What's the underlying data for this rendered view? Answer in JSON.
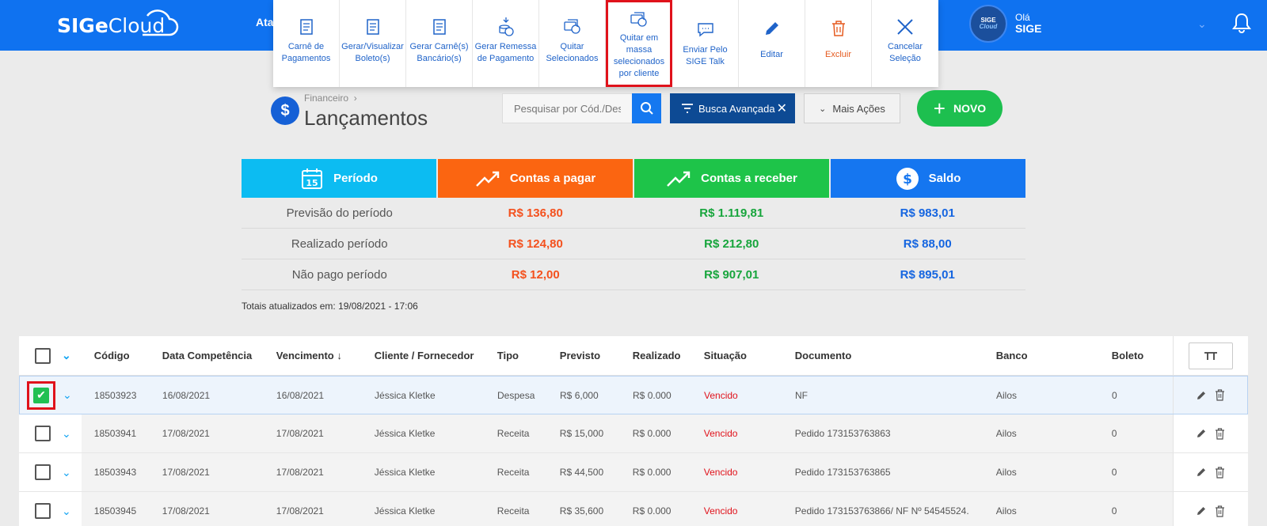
{
  "topbar": {
    "logo_sige": "SIGe",
    "logo_cloud": "Cloud",
    "nav_cut": "Ata",
    "user": {
      "avatar_top": "SIGE",
      "avatar_bottom": "Cloud",
      "greeting": "Olá",
      "name": "SIGE"
    }
  },
  "actions": [
    {
      "label": "Carnê de Pagamentos",
      "icon": "doc-icon"
    },
    {
      "label": "Gerar/Visualizar Boleto(s)",
      "icon": "doc-icon"
    },
    {
      "label": "Gerar Carnê(s) Bancário(s)",
      "icon": "doc-icon"
    },
    {
      "label": "Gerar Remessa de Pagamento",
      "icon": "money-download-icon"
    },
    {
      "label": "Quitar Selecionados",
      "icon": "coins-icon"
    },
    {
      "label": "Quitar em massa selecionados por cliente",
      "icon": "coins-icon"
    },
    {
      "label": "Enviar Pelo SIGE Talk",
      "icon": "chat-icon"
    },
    {
      "label": "Editar",
      "icon": "pencil-icon"
    },
    {
      "label": "Excluir",
      "icon": "trash-icon"
    },
    {
      "label": "Cancelar Seleção",
      "icon": "close-icon"
    }
  ],
  "page": {
    "breadcrumb": "Financeiro",
    "title": "Lançamentos"
  },
  "search": {
    "placeholder": "Pesquisar por Cód./Desc"
  },
  "advanced_search": "Busca Avançada",
  "more_actions": "Mais Ações",
  "new_button": "NOVO",
  "summary": {
    "headers": [
      {
        "label": "Período",
        "color": "#0cbcf2"
      },
      {
        "label": "Contas a pagar",
        "color": "#fb6511"
      },
      {
        "label": "Contas a receber",
        "color": "#1ec449"
      },
      {
        "label": "Saldo",
        "color": "#1576f0"
      }
    ],
    "rows": [
      {
        "label": "Previsão do período",
        "pagar": "R$ 136,80",
        "receber": "R$ 1.119,81",
        "saldo": "R$ 983,01"
      },
      {
        "label": "Realizado período",
        "pagar": "R$ 124,80",
        "receber": "R$ 212,80",
        "saldo": "R$ 88,00"
      },
      {
        "label": "Não pago período",
        "pagar": "R$ 12,00",
        "receber": "R$ 907,01",
        "saldo": "R$ 895,01"
      }
    ],
    "colors": {
      "pagar": "#f4511e",
      "receber": "#17a53c",
      "saldo": "#1565e0"
    },
    "totals": "Totais atualizados em: 19/08/2021 - 17:06"
  },
  "table": {
    "columns": [
      "Código",
      "Data Competência",
      "Vencimento ↓",
      "Cliente / Fornecedor",
      "Tipo",
      "Previsto",
      "Realizado",
      "Situação",
      "Documento",
      "Banco",
      "Boleto"
    ],
    "rows": [
      {
        "codigo": "18503923",
        "competencia": "16/08/2021",
        "vencimento": "16/08/2021",
        "cliente": "Jéssica Kletke",
        "tipo": "Despesa",
        "previsto": "R$ 6,000",
        "realizado": "R$ 0.000",
        "situacao": "Vencido",
        "documento": "NF",
        "banco": "Ailos",
        "boleto": "0"
      },
      {
        "codigo": "18503941",
        "competencia": "17/08/2021",
        "vencimento": "17/08/2021",
        "cliente": "Jéssica Kletke",
        "tipo": "Receita",
        "previsto": "R$ 15,000",
        "realizado": "R$ 0.000",
        "situacao": "Vencido",
        "documento": "Pedido 173153763863",
        "banco": "Ailos",
        "boleto": "0"
      },
      {
        "codigo": "18503943",
        "competencia": "17/08/2021",
        "vencimento": "17/08/2021",
        "cliente": "Jéssica Kletke",
        "tipo": "Receita",
        "previsto": "R$ 44,500",
        "realizado": "R$ 0.000",
        "situacao": "Vencido",
        "documento": "Pedido 173153763865",
        "banco": "Ailos",
        "boleto": "0"
      },
      {
        "codigo": "18503945",
        "competencia": "17/08/2021",
        "vencimento": "17/08/2021",
        "cliente": "Jéssica Kletke",
        "tipo": "Receita",
        "previsto": "R$ 35,600",
        "realizado": "R$ 0.000",
        "situacao": "Vencido",
        "documento": "Pedido 173153763866/ NF Nº 54545524.",
        "banco": "Ailos",
        "boleto": "0"
      }
    ]
  }
}
